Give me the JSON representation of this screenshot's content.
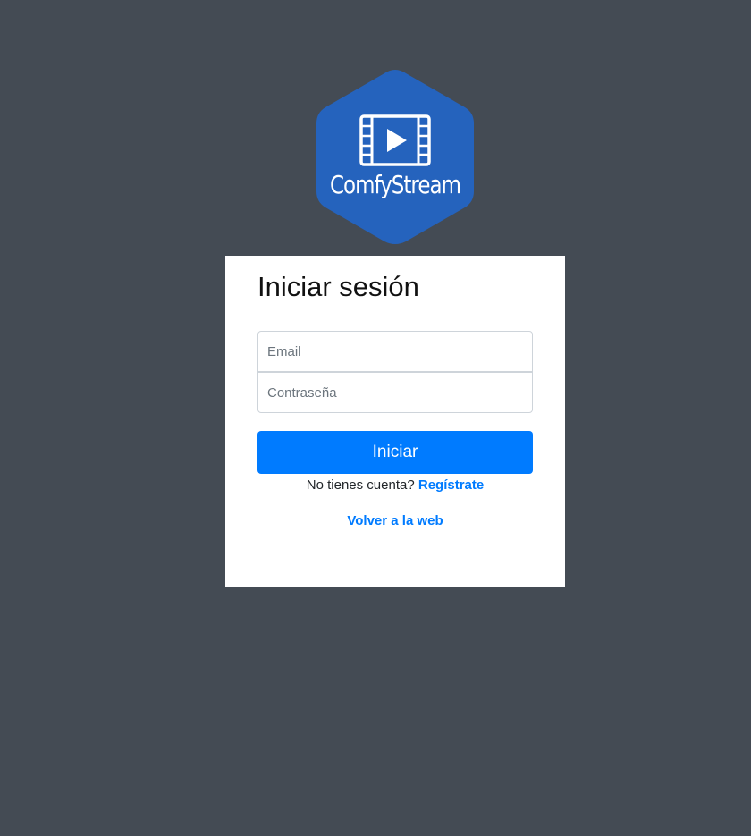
{
  "logo": {
    "brand_text": "ComfyStream",
    "icon": "film-play-icon",
    "color": "#2563bd"
  },
  "login": {
    "title": "Iniciar sesión",
    "email_placeholder": "Email",
    "password_placeholder": "Contraseña",
    "submit_label": "Iniciar",
    "no_account_text": "No tienes cuenta?",
    "register_link": "Regístrate",
    "back_link": "Volver a la web"
  },
  "colors": {
    "background": "#444b54",
    "primary": "#007bff",
    "card": "#ffffff"
  }
}
